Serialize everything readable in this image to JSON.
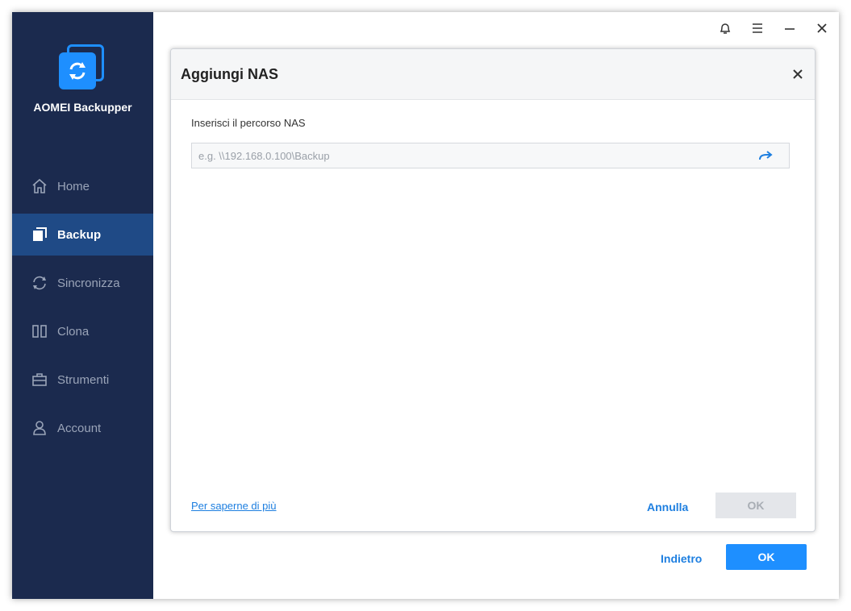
{
  "app": {
    "name": "AOMEI Backupper"
  },
  "sidebar": {
    "items": [
      {
        "label": "Home",
        "icon": "home-icon"
      },
      {
        "label": "Backup",
        "icon": "backup-icon",
        "active": true
      },
      {
        "label": "Sincronizza",
        "icon": "sync-icon"
      },
      {
        "label": "Clona",
        "icon": "clone-icon"
      },
      {
        "label": "Strumenti",
        "icon": "toolbox-icon"
      },
      {
        "label": "Account",
        "icon": "user-icon"
      }
    ]
  },
  "titlebar": {
    "icons": [
      "bell-icon",
      "menu-icon",
      "minimize-icon",
      "close-icon"
    ]
  },
  "dialog": {
    "title": "Aggiungi NAS",
    "field_label": "Inserisci il percorso NAS",
    "path_value": "",
    "path_placeholder": "e.g. \\\\192.168.0.100\\Backup",
    "learn_more": "Per saperne di più",
    "cancel_label": "Annulla",
    "ok_label": "OK"
  },
  "footer": {
    "back_label": "Indietro",
    "ok_label": "OK"
  },
  "colors": {
    "sidebar_bg": "#1b2a4e",
    "sidebar_active": "#1f4a86",
    "accent": "#1e8fff",
    "link": "#1e7fe0"
  }
}
